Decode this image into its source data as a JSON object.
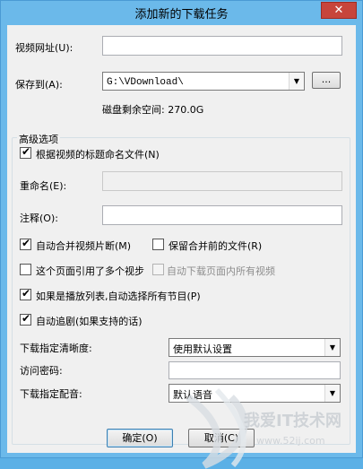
{
  "window": {
    "title": "添加新的下载任务",
    "close_glyph": "✕"
  },
  "form": {
    "url_label": "视频网址(U):",
    "url_value": "",
    "save_label": "保存到(A):",
    "save_path": "G:\\VDownload\\",
    "browse_label": "...",
    "disk_space": "磁盘剩余空间: 270.0G"
  },
  "advanced": {
    "legend": "高级选项",
    "name_by_title": {
      "label": "根据视频的标题命名文件(N)",
      "checked": true
    },
    "rename_label": "重命名(E):",
    "rename_value": "",
    "note_label": "注释(O):",
    "note_value": "",
    "auto_merge": {
      "label": "自动合并视频片断(M)",
      "checked": true
    },
    "keep_before_merge": {
      "label": "保留合并前的文件(R)",
      "checked": false
    },
    "multi_video": {
      "label": "这个页面引用了多个视步",
      "checked": false
    },
    "download_all": {
      "label": "自动下载页面内所有视频",
      "checked": false,
      "disabled": true
    },
    "playlist_all": {
      "label": "如果是播放列表,自动选择所有节目(P)",
      "checked": true
    },
    "auto_follow": {
      "label": "自动追剧(如果支持的话)",
      "checked": true
    },
    "quality_label": "下载指定清晰度:",
    "quality_value": "使用默认设置",
    "password_label": "访问密码:",
    "password_value": "",
    "dub_label": "下载指定配音:",
    "dub_value": "默认语音"
  },
  "buttons": {
    "ok": "确定(O)",
    "cancel": "取消(C)"
  },
  "watermark": {
    "text": "我爱IT技术网",
    "url": "www.52ij.com"
  },
  "icons": {
    "dropdown": "▼",
    "check": "✔"
  }
}
